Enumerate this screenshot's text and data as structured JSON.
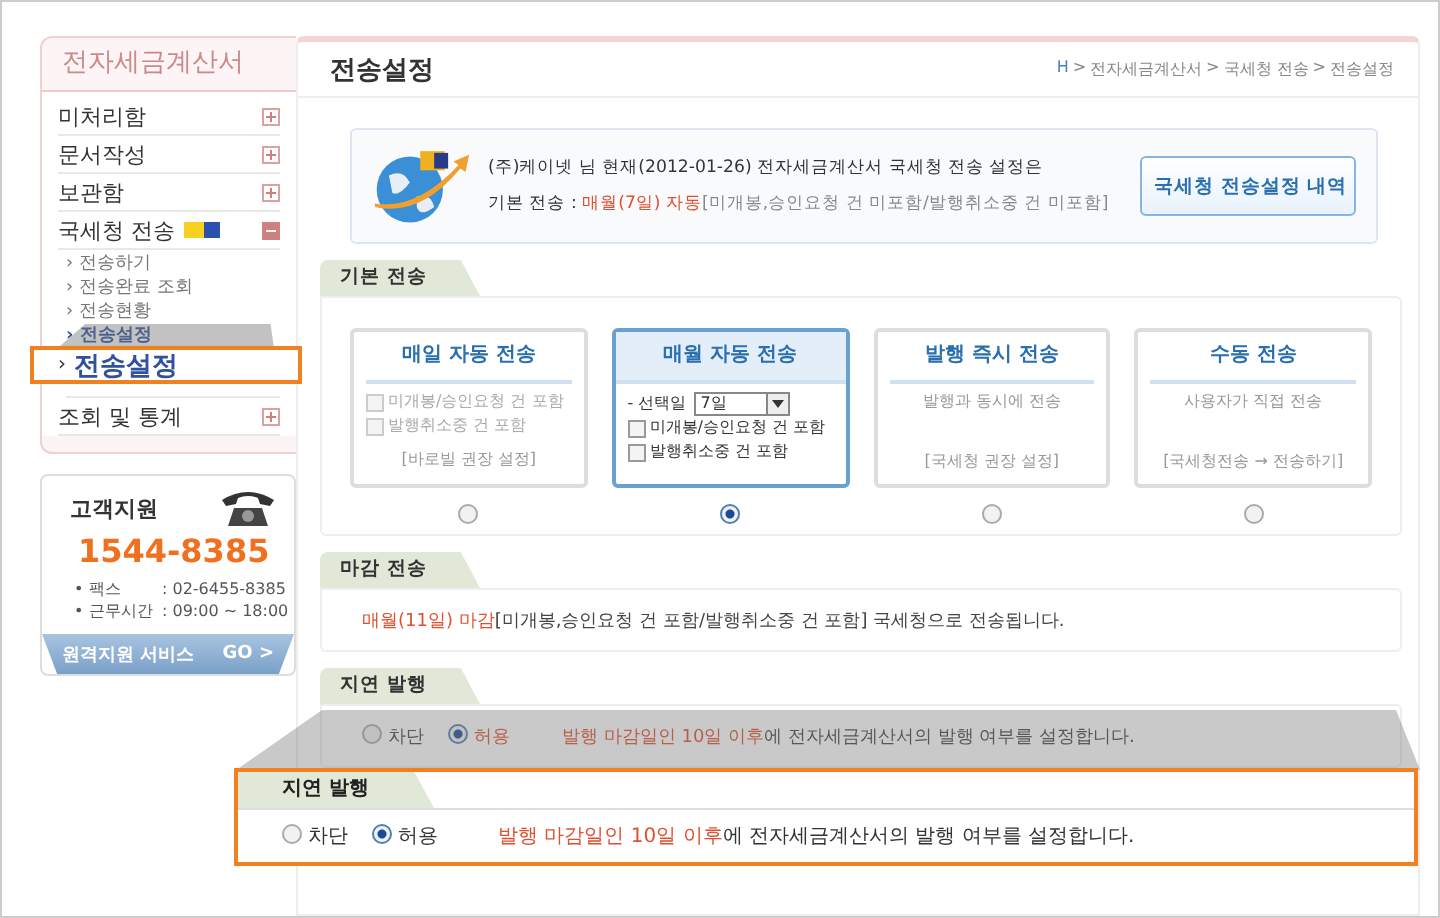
{
  "sidebar": {
    "title": "전자세금계산서",
    "menu": [
      {
        "label": "미처리함",
        "expanded": false
      },
      {
        "label": "문서작성",
        "expanded": false
      },
      {
        "label": "보관함",
        "expanded": false
      },
      {
        "label": "국세청 전송",
        "expanded": true,
        "children": [
          {
            "label": "› 전송하기",
            "selected": false
          },
          {
            "label": "› 전송완료 조회",
            "selected": false
          },
          {
            "label": "› 전송현황",
            "selected": false
          },
          {
            "label": "› 전송설정",
            "selected": true
          }
        ]
      },
      {
        "label": "조회 및 통계",
        "expanded": false
      }
    ],
    "support": {
      "title": "고객지원",
      "phone": "1544-8385",
      "lines": [
        {
          "label": "• 팩스",
          "value": ": 02-6455-8385"
        },
        {
          "label": "• 근무시간",
          "value": ": 09:00 ~ 18:00"
        }
      ],
      "remote_button": "원격지원 서비스",
      "go": "GO >"
    }
  },
  "sidebar_callout": {
    "marker": "›",
    "label": "전송설정"
  },
  "page": {
    "title": "전송설정",
    "breadcrumb": [
      "H",
      "전자세금계산서",
      "국세청 전송",
      "전송설정"
    ],
    "separator": ">"
  },
  "info": {
    "line1": "(주)케이넷 님 현재(2012-01-26) 전자세금계산서 국세청 전송 설정은",
    "label": "기본 전송 : ",
    "highlight": "매월(7일) 자동",
    "rest": "[미개봉,승인요청 건 미포함/발행취소중 건 미포함]",
    "button": "국세청 전송설정 내역"
  },
  "basic": {
    "title": "기본 전송",
    "options": [
      {
        "title": "매일 자동 전송",
        "selected": false,
        "kind": "checks",
        "checks": [
          {
            "label": "미개봉/승인요청 건 포함",
            "checked": false
          },
          {
            "label": "발행취소중 건 포함",
            "checked": false
          }
        ],
        "note": "[바로빌 권장 설정]"
      },
      {
        "title": "매월 자동 전송",
        "selected": true,
        "kind": "select",
        "select_label": "- 선택일",
        "select_value": "7일",
        "checks": [
          {
            "label": "미개봉/승인요청 건 포함",
            "checked": false
          },
          {
            "label": "발행취소중 건 포함",
            "checked": false
          }
        ]
      },
      {
        "title": "발행 즉시 전송",
        "selected": false,
        "kind": "text",
        "description": "발행과 동시에 전송",
        "note": "[국세청 권장 설정]"
      },
      {
        "title": "수동 전송",
        "selected": false,
        "kind": "text",
        "description": "사용자가 직접 전송",
        "note": "[국세청전송 → 전송하기]"
      }
    ]
  },
  "deadline": {
    "title": "마감 전송",
    "highlight": "매월(11일) 마감",
    "rest": "[미개봉,승인요청 건 포함/발행취소중 건 포함] 국세청으로 전송됩니다."
  },
  "delay": {
    "title": "지연 발행",
    "options": [
      {
        "label": "차단",
        "selected": false
      },
      {
        "label": "허용",
        "selected": true
      }
    ],
    "highlight": "발행 마감일인 10일 이후",
    "rest": "에 전자세금계산서의 발행 여부를 설정합니다."
  },
  "delay_callout": {
    "title": "지연 발행",
    "options": [
      {
        "label": "차단",
        "selected": false
      },
      {
        "label": "허용",
        "selected": true
      }
    ],
    "highlight": "발행 마감일인 10일 이후",
    "rest": "에 전자세금계산서의 발행 여부를 설정합니다."
  }
}
